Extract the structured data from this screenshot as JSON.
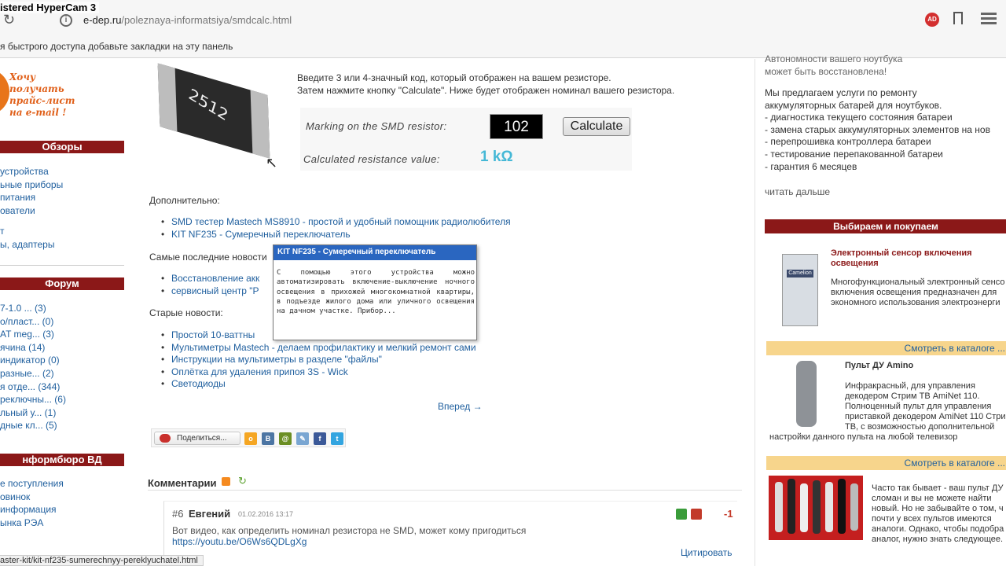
{
  "watermark": "istered HyperCam 3",
  "browser": {
    "url_domain": "e-dep.ru",
    "url_path": "/poleznaya-informatsiya/smdcalc.html",
    "bookmarks_hint": "я быстрого доступа добавьте закладки на эту панель",
    "ad_badge": "AD"
  },
  "left": {
    "promo": [
      "Хочу",
      "получать",
      "прайс-лист",
      "на e-mail !"
    ],
    "sections": [
      {
        "title": "Обзоры",
        "items": [
          "устройства",
          "ьные приборы",
          "питания",
          "ователи",
          "т",
          "ы, адаптеры"
        ]
      },
      {
        "title": "Форум",
        "items": [
          "7-1.0 ... (3)",
          "о/пласт... (0)",
          "AT meg... (3)",
          "ячина (14)",
          "индикатор (0)",
          "разные... (2)",
          "я отде... (344)",
          "реключны... (6)",
          "льный у... (1)",
          "дные кл... (5)"
        ]
      },
      {
        "title": "нформбюро ВД",
        "items": [
          "е поступления",
          "овинок",
          "информация",
          "ынка РЭА"
        ]
      }
    ]
  },
  "center": {
    "resistor_label": "2512",
    "intro_1": "Введите 3 или 4-значный код, который отображен на вашем резисторе.",
    "intro_2": "Затем нажмите кнопку \"Calculate\". Ниже будет отображен номинал вашего резистора.",
    "calc": {
      "marking_label": "Marking on the SMD resistor:",
      "code_value": "102",
      "button": "Calculate",
      "result_label": "Calculated resistance value:",
      "result_value": "1 kΩ"
    },
    "additional_title": "Дополнительно:",
    "additional": [
      "SMD тестер Mastech MS8910 - простой и удобный помощник радиолюбителя",
      "KIT NF235 - Сумеречный переключатель"
    ],
    "latest_title": "Самые последние новости",
    "latest": [
      "Восстановление акк",
      "сервисный центр \"Р"
    ],
    "old_title": "Старые новости:",
    "old": [
      "Простой 10-ваттны",
      "Мультиметры Mastech - делаем профилактику и мелкий ремонт сами",
      "Инструкции на мультиметры в разделе \"файлы\"",
      "Оплётка для удаления припоя 3S - Wick",
      "Светодиоды"
    ],
    "tooltip": {
      "title": "KIT NF235 - Сумеречный переключатель",
      "body": "С помощью этого устройства можно автоматизировать включение-выключение ночного освещения в прихожей многокомнатной квартиры, в подъезде жилого дома или уличного освещения на дачном участке. Прибор..."
    },
    "next": "Вперед →",
    "share_label": "Поделиться...",
    "comments_title": "Комментарии",
    "comment": {
      "num": "#6",
      "author": "Евгений",
      "date": "01.02.2016 13:17",
      "score": "-1",
      "text": "Вот видео, как определить номинал резистора не SMD, может кому пригодиться",
      "link": "https://youtu.be/O6Ws6QDLgXg",
      "quote": "Цитировать"
    },
    "status_url": "aster-kit/kit-nf235-sumerechnyy-pereklyuchatel.html"
  },
  "right": {
    "top_lines": [
      "Автономности вашего ноутбука",
      "может быть восстановлена!"
    ],
    "services_intro": [
      "Мы предлагаем услуги по ремонту",
      "аккумуляторных батарей для ноутбуков."
    ],
    "services": [
      " - диагностика текущего состояния батареи",
      " - замена старых аккумуляторных элементов на нов",
      " - перепрошивка контроллера батареи",
      " - тестирование перепакованной батареи",
      " - гарантия 6 месяцев"
    ],
    "read_more": "читать дальше",
    "buy_title": "Выбираем и покупаем",
    "product1": {
      "title": [
        "Электронный сенсор включения",
        "освещения"
      ],
      "brand": "Camelion",
      "text": [
        "Многофункциональный электронный сенсо",
        "включения освещения предназначен для",
        "экономного использования электроэнерги"
      ]
    },
    "catalog_link": "Смотреть в каталоге ...",
    "product2": {
      "title": "Пульт ДУ Amino",
      "text": [
        "Инфракрасный, для управления",
        "декодером Стрим ТВ AmiNet 110.",
        "Полноценный пульт для управления",
        "приставкой декодером AmiNet 110 Стри",
        "ТВ, с возможностью дополнительной",
        "настройки данного пульта на любой телевизор"
      ]
    },
    "product3": {
      "text": [
        "Часто так бывает - ваш пульт ДУ",
        "сломан и вы не можете найти",
        "новый. Но не забывайте о том, ч",
        "почти у всех пультов имеются",
        "аналоги. Однако, чтобы подобра",
        "аналог, нужно знать следующее."
      ]
    }
  }
}
